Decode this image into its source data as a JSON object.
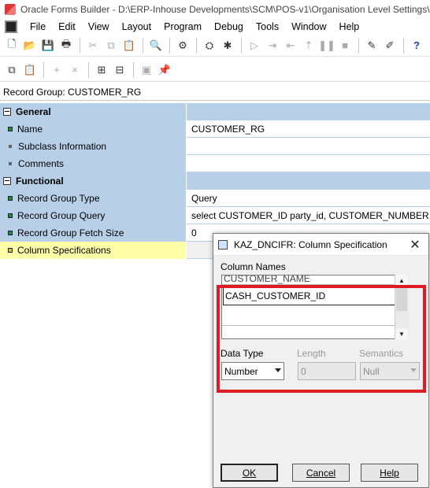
{
  "window": {
    "title": "Oracle Forms Builder - D:\\ERP-Inhouse Developments\\SCM\\POS-v1\\Organisation Level Settings\\KA"
  },
  "menu": [
    "File",
    "Edit",
    "View",
    "Layout",
    "Program",
    "Debug",
    "Tools",
    "Window",
    "Help"
  ],
  "toolbar1": [
    "new-icon",
    "open-icon",
    "save-icon",
    "print-icon",
    "cut-icon",
    "copy-icon",
    "paste-icon",
    "find-icon",
    "compile-icon",
    "run-form-icon",
    "run-debug-icon",
    "step-icon",
    "step-into-icon",
    "step-out-icon",
    "stop-icon",
    "pause-icon",
    "wizard-icon",
    "layout-wizard-icon",
    "help-icon"
  ],
  "toolbar2": [
    "copy-properties-icon",
    "paste-properties-icon",
    "add-icon",
    "delete-icon",
    "intersection-icon",
    "union-icon",
    "inherit-icon",
    "pin-icon"
  ],
  "record_group_label": "Record Group: CUSTOMER_RG",
  "properties": {
    "general_header": "General",
    "name_label": "Name",
    "name_value": "CUSTOMER_RG",
    "subclass_label": "Subclass Information",
    "comments_label": "Comments",
    "functional_header": "Functional",
    "type_label": "Record Group Type",
    "type_value": "Query",
    "query_label": "Record Group Query",
    "query_value": "select CUSTOMER_ID party_id, CUSTOMER_NUMBER, CUS",
    "fetch_label": "Record Group Fetch Size",
    "fetch_value": "0",
    "colspec_label": "Column Specifications"
  },
  "dialog": {
    "title": "KAZ_DNCIFR: Column Specification",
    "column_names_label": "Column Names",
    "columns": [
      "CUSTOMER_NAME",
      "CASH_CUSTOMER_ID",
      ""
    ],
    "data_type_label": "Data Type",
    "data_type_value": "Number",
    "length_label": "Length",
    "length_value": "0",
    "semantics_label": "Semantics",
    "semantics_value": "Null",
    "ok_label": "OK",
    "cancel_label": "Cancel",
    "help_label": "Help"
  },
  "colors": {
    "highlight": "#e01b24",
    "property_header": "#b8cfe8",
    "selected_row": "#ffffa8"
  }
}
